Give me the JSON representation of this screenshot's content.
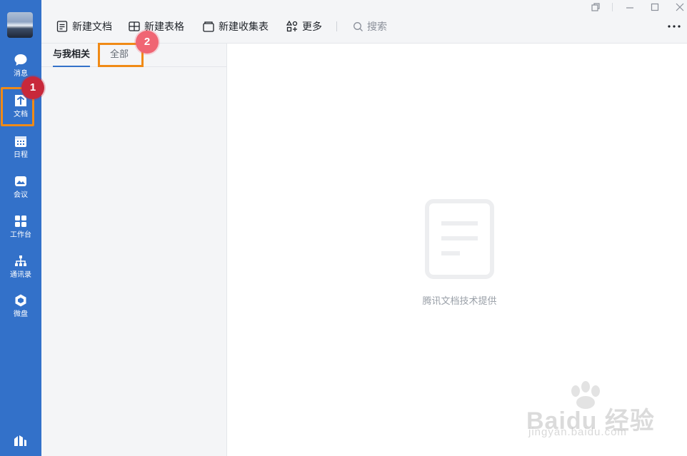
{
  "rail": {
    "items": [
      {
        "label": "消息",
        "icon": "chat-bubble-icon"
      },
      {
        "label": "文档",
        "icon": "document-icon"
      },
      {
        "label": "日程",
        "icon": "calendar-icon"
      },
      {
        "label": "会议",
        "icon": "meeting-icon"
      },
      {
        "label": "工作台",
        "icon": "workbench-grid-icon"
      },
      {
        "label": "通讯录",
        "icon": "org-chart-icon"
      },
      {
        "label": "微盘",
        "icon": "drive-icon"
      }
    ]
  },
  "toolbar": {
    "new_doc": "新建文档",
    "new_sheet": "新建表格",
    "new_form": "新建收集表",
    "more": "更多",
    "search": "搜索"
  },
  "tabs": {
    "related": "与我相关",
    "all": "全部"
  },
  "content": {
    "empty_caption": "腾讯文档技术提供"
  },
  "annotations": {
    "badge1": "1",
    "badge2": "2",
    "highlight_color": "#f08a16"
  },
  "watermark": {
    "brand": "Baidu 经验",
    "url": "jingyan.baidu.com"
  },
  "colors": {
    "rail": "#3371c9",
    "accent": "#3371c9"
  }
}
